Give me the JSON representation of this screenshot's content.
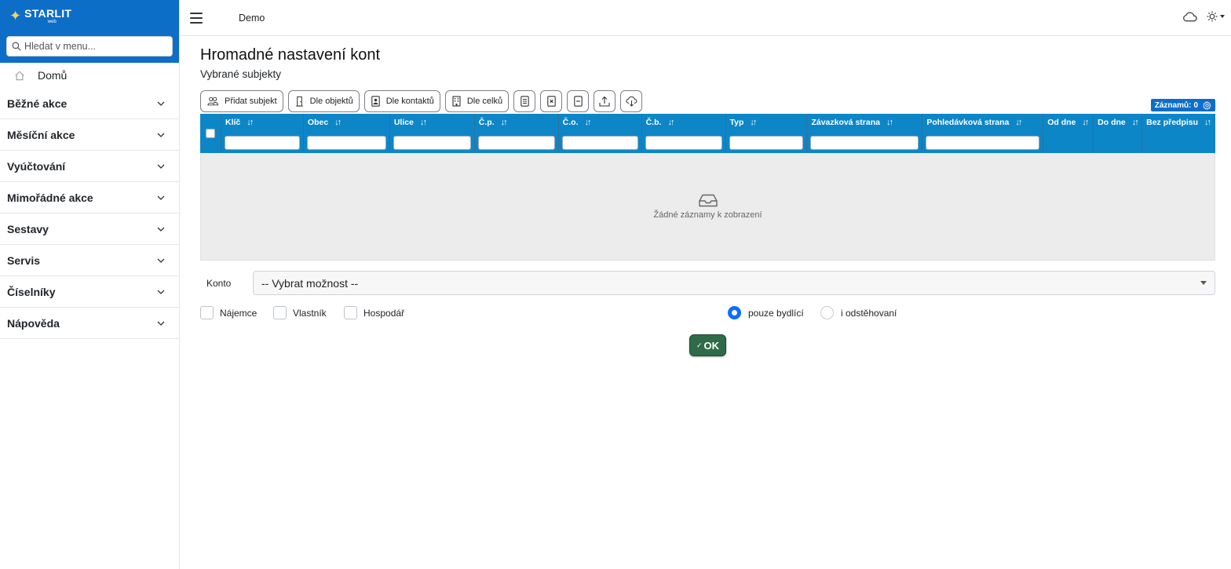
{
  "brand": {
    "name": "STARLIT",
    "sub": "web"
  },
  "sidebar": {
    "search_placeholder": "Hledat v menu...",
    "home_label": "Domů",
    "items": [
      {
        "label": "Běžné akce"
      },
      {
        "label": "Měsíční akce"
      },
      {
        "label": "Vyúčtování"
      },
      {
        "label": "Mimořádné akce"
      },
      {
        "label": "Sestavy"
      },
      {
        "label": "Servis"
      },
      {
        "label": "Číselníky"
      },
      {
        "label": "Nápověda"
      }
    ]
  },
  "header": {
    "title": "Demo"
  },
  "page": {
    "title": "Hromadné nastavení kont",
    "subtitle": "Vybrané subjekty"
  },
  "toolbar": {
    "add_subject": "Přidat subjekt",
    "by_objects": "Dle objektů",
    "by_contacts": "Dle kontaktů",
    "by_units": "Dle celků",
    "records_label": "Záznamů:",
    "records_count": "0"
  },
  "table": {
    "columns": [
      "Klíč",
      "Obec",
      "Ulice",
      "Č.p.",
      "Č.o.",
      "Č.b.",
      "Typ",
      "Závazková strana",
      "Pohledávková strana",
      "Od dne",
      "Do dne",
      "Bez předpisu"
    ],
    "empty_text": "Žádné záznamy k zobrazení"
  },
  "form": {
    "konto_label": "Konto",
    "konto_value": "-- Vybrat možnost --",
    "checkboxes": [
      "Nájemce",
      "Vlastník",
      "Hospodář"
    ],
    "radio_options": [
      "pouze bydlící",
      "i odstěhovaní"
    ],
    "radio_selected": "pouze bydlící",
    "ok_label": "OK"
  },
  "colors": {
    "primary": "#0d6ec8",
    "table_header": "#0d86c8",
    "ok_button": "#2f6b48"
  }
}
